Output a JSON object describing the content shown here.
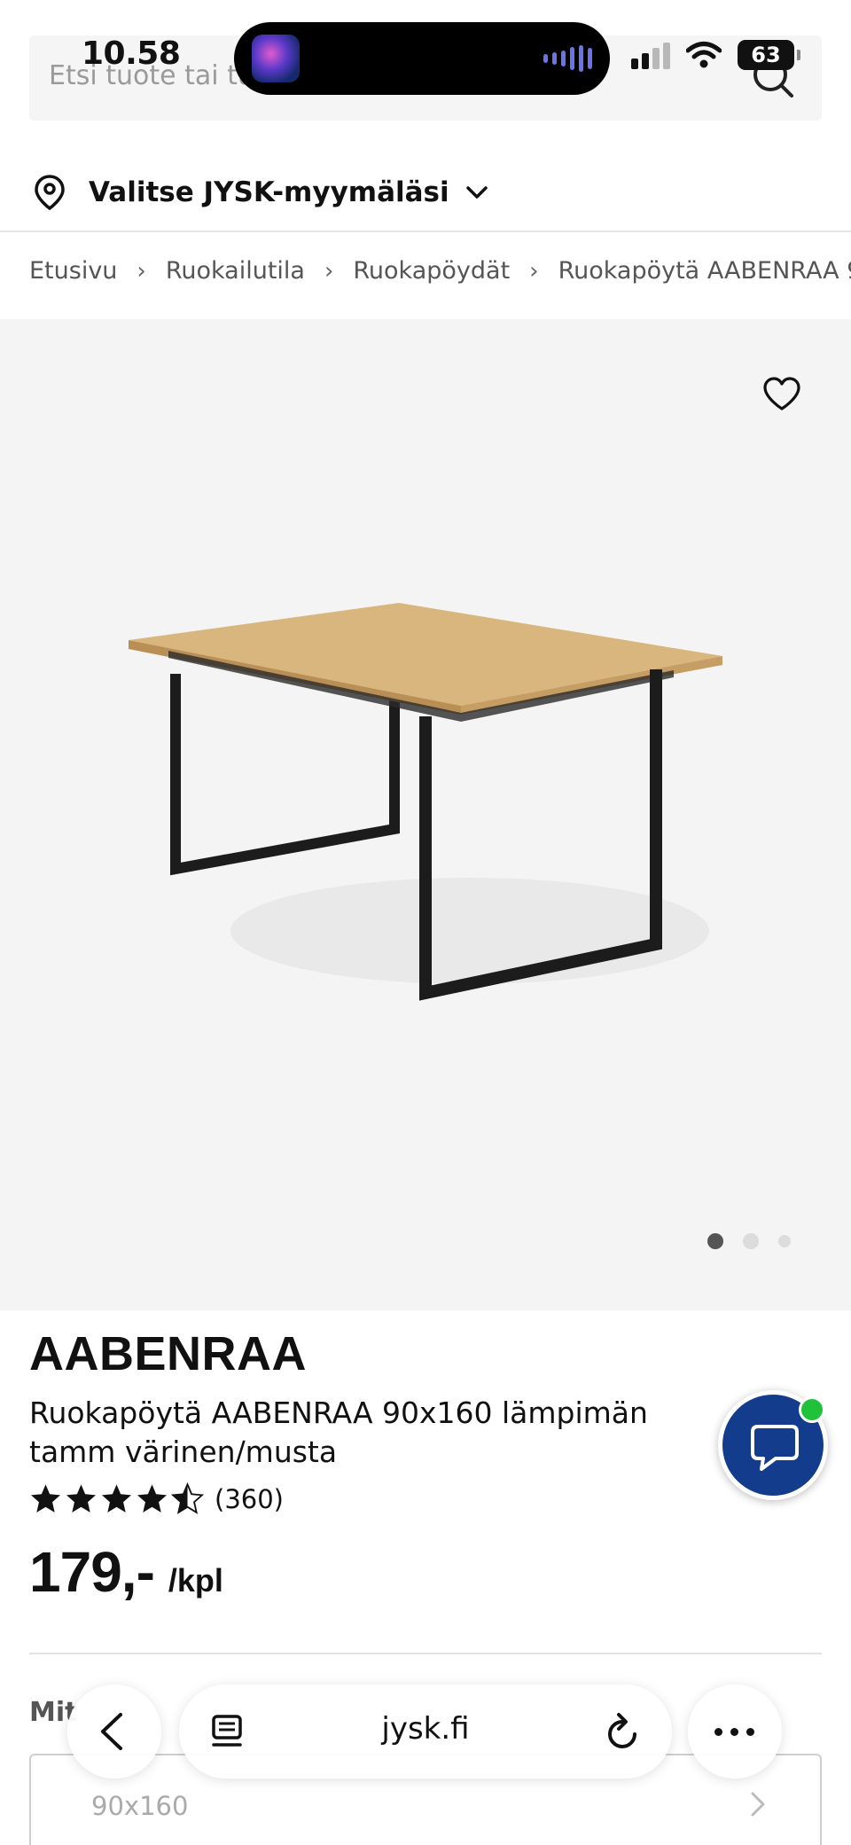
{
  "status_bar": {
    "time": "10.58",
    "battery": "63"
  },
  "search": {
    "placeholder": "Etsi tuote tai tu"
  },
  "store": {
    "label": "Valitse JYSK-myymäläsi"
  },
  "breadcrumb": {
    "items": [
      "Etusivu",
      "Ruokailutila",
      "Ruokapöydät",
      "Ruokapöytä AABENRAA 90x"
    ],
    "separator": "›"
  },
  "gallery": {
    "image_count": 3,
    "active_index": 0
  },
  "product": {
    "brand": "AABENRAA",
    "title": "Ruokapöytä AABENRAA 90x160 lämpimän tamm värinen/musta",
    "rating": 4.5,
    "review_count": "(360)",
    "price": "179,-",
    "unit": "/kpl"
  },
  "options": {
    "label": "Mit",
    "size_value": "90x160"
  },
  "browser": {
    "url": "jysk.fi"
  },
  "colors": {
    "accent_chat": "#143c8c",
    "online": "#1fc23a",
    "gallery_bg": "#f4f4f4",
    "table_top": "#d9b67e",
    "table_legs": "#1c1c1c"
  }
}
